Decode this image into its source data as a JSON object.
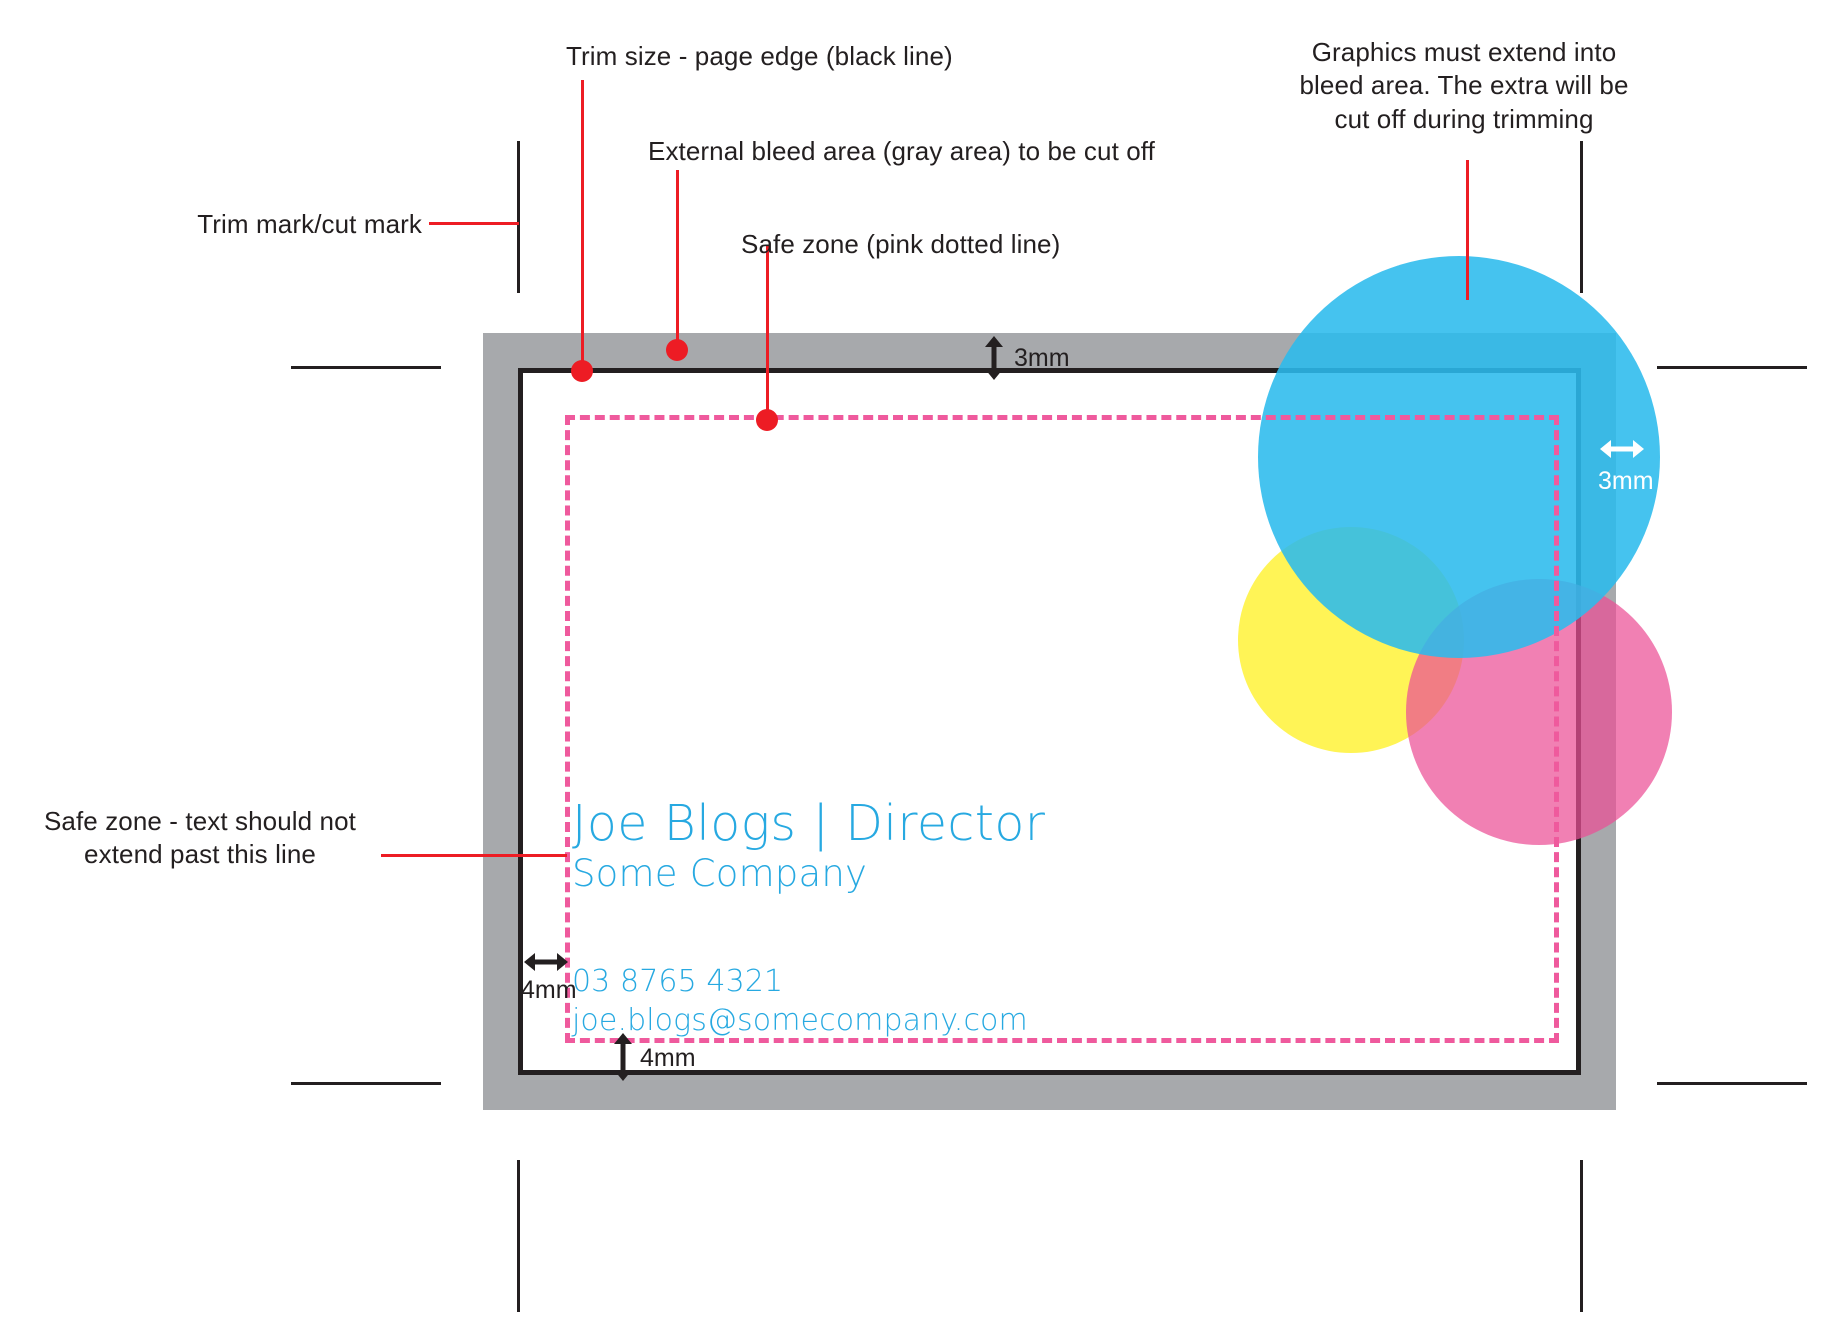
{
  "annotations": {
    "trim_mark": "Trim mark/cut mark",
    "trim_size": "Trim size - page edge (black line)",
    "bleed_area": "External bleed area (gray area) to be cut off",
    "safe_zone": "Safe zone (pink dotted line)",
    "graphics_bleed": "Graphics must extend into\nbleed area. The extra will be\ncut off during trimming",
    "safe_zone_text": "Safe zone - text should not\nextend past this line"
  },
  "measurements": {
    "top_bleed": "3mm",
    "right_bleed": "3mm",
    "left_margin": "4mm",
    "bottom_margin": "4mm"
  },
  "card": {
    "name": "Joe Blogs  |  Director",
    "company": "Some Company",
    "phone": "03 8765 4321",
    "email": "joe.blogs@somecompany.com"
  },
  "colors": {
    "leader_red": "#ed1c24",
    "bleed_gray": "#a7a9ac",
    "trim_black": "#231f20",
    "safe_pink": "#ef5a9d",
    "card_blue": "#27a9e1",
    "cyan": "#2bbbed",
    "yellow": "#fff33f",
    "magenta": "#ec4f96"
  }
}
